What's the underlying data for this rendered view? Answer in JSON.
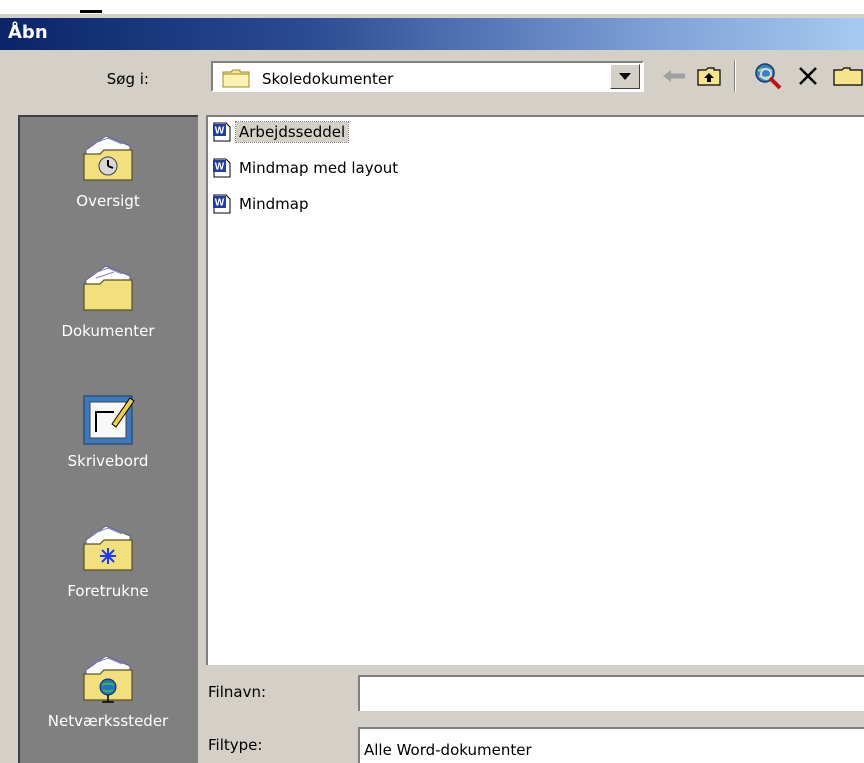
{
  "window": {
    "title": "Åbn"
  },
  "toolbar": {
    "lookin_label": "Søg i:",
    "lookin_value": "Skoledokumenter"
  },
  "places": [
    {
      "label": "Oversigt"
    },
    {
      "label": "Dokumenter"
    },
    {
      "label": "Skrivebord"
    },
    {
      "label": "Foretrukne"
    },
    {
      "label": "Netværkssteder"
    }
  ],
  "files": [
    {
      "name": "Arbejdsseddel",
      "selected": true
    },
    {
      "name": "Mindmap med layout",
      "selected": false
    },
    {
      "name": "Mindmap",
      "selected": false
    }
  ],
  "fields": {
    "filename_label": "Filnavn:",
    "filename_value": "",
    "filetype_label": "Filtype:",
    "filetype_value": "Alle Word-dokumenter"
  },
  "colors": {
    "titlebar_start": "#0a246a",
    "titlebar_end": "#a6caf0",
    "dialog_face": "#d4d0c8",
    "places_bar": "#808080",
    "word_icon_blue": "#1f3fa6"
  }
}
